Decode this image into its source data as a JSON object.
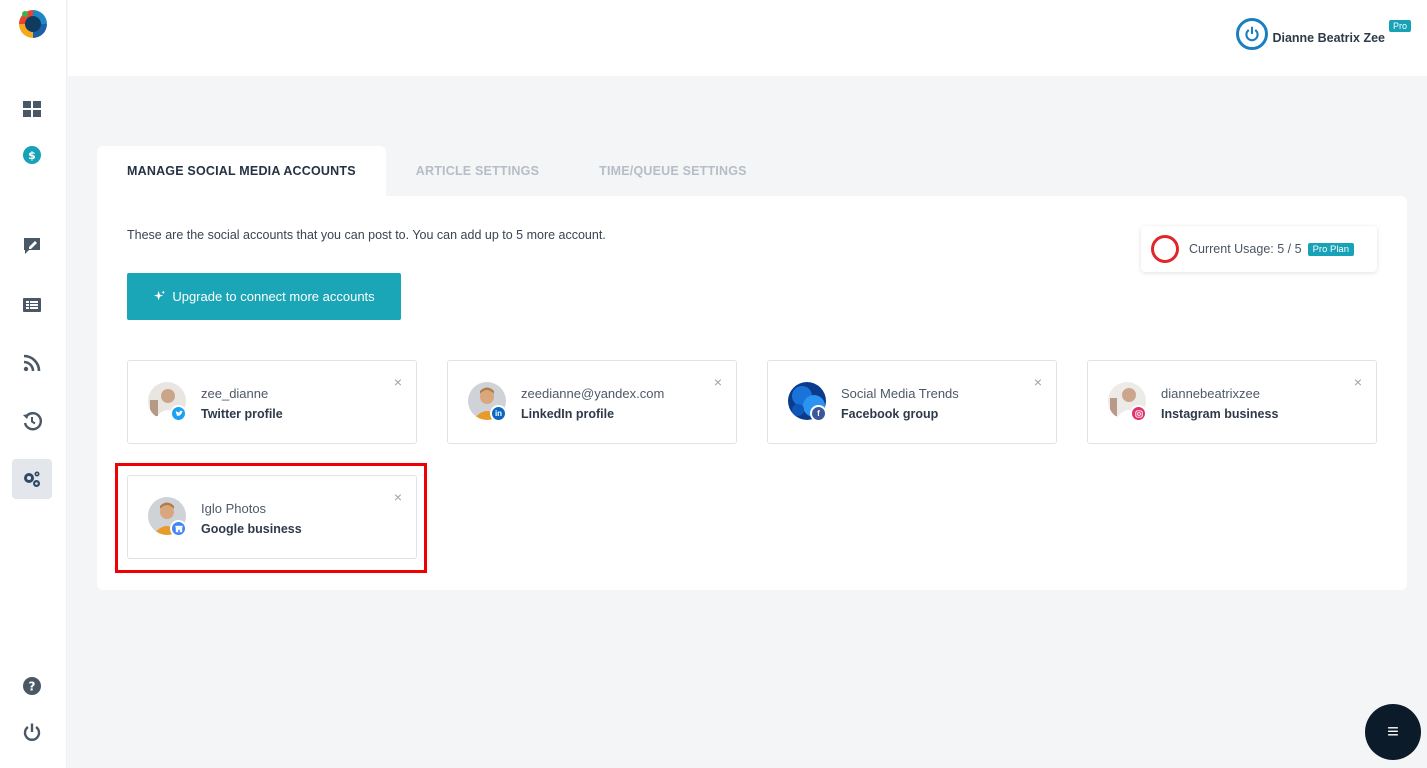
{
  "header": {
    "user_name": "Dianne Beatrix Zee",
    "user_badge": "Pro"
  },
  "sidebar": {
    "items": [
      {
        "icon": "dashboard-grid-icon"
      },
      {
        "icon": "billing-badge-icon"
      },
      {
        "icon": "compose-post-icon"
      },
      {
        "icon": "articles-list-icon"
      },
      {
        "icon": "rss-feed-icon"
      },
      {
        "icon": "history-icon"
      },
      {
        "icon": "settings-gears-icon",
        "active": true
      },
      {
        "icon": "help-icon"
      },
      {
        "icon": "power-icon"
      }
    ]
  },
  "tabs": [
    {
      "label": "MANAGE SOCIAL MEDIA ACCOUNTS",
      "active": true
    },
    {
      "label": "ARTICLE SETTINGS",
      "active": false
    },
    {
      "label": "TIME/QUEUE SETTINGS",
      "active": false
    }
  ],
  "panel": {
    "intro": "These are the social accounts that you can post to. You can add up to 5 more account.",
    "upgrade_label": "Upgrade to connect more accounts",
    "usage_label": "Current Usage: 5 / 5",
    "usage_badge": "Pro Plan",
    "usage_fraction": 1.0
  },
  "accounts": [
    {
      "name": "zee_dianne",
      "type": "Twitter profile",
      "network": "twitter",
      "network_color": "#1da1f2"
    },
    {
      "name": "zeedianne@yandex.com",
      "type": "LinkedIn profile",
      "network": "linkedin",
      "network_color": "#0a66c2"
    },
    {
      "name": "Social Media Trends",
      "type": "Facebook group",
      "network": "facebook",
      "network_color": "#3b5998"
    },
    {
      "name": "diannebeatrixzee",
      "type": "Instagram business",
      "network": "instagram",
      "network_color": "#e1306c"
    },
    {
      "name": "Iglo Photos",
      "type": "Google business",
      "network": "google-business",
      "network_color": "#4285f4"
    }
  ],
  "colors": {
    "accent": "#1aa6b7",
    "highlight": "#f00000",
    "usage_ring": "#e2242b"
  },
  "close_glyph": "×",
  "fab_glyph": "≡"
}
